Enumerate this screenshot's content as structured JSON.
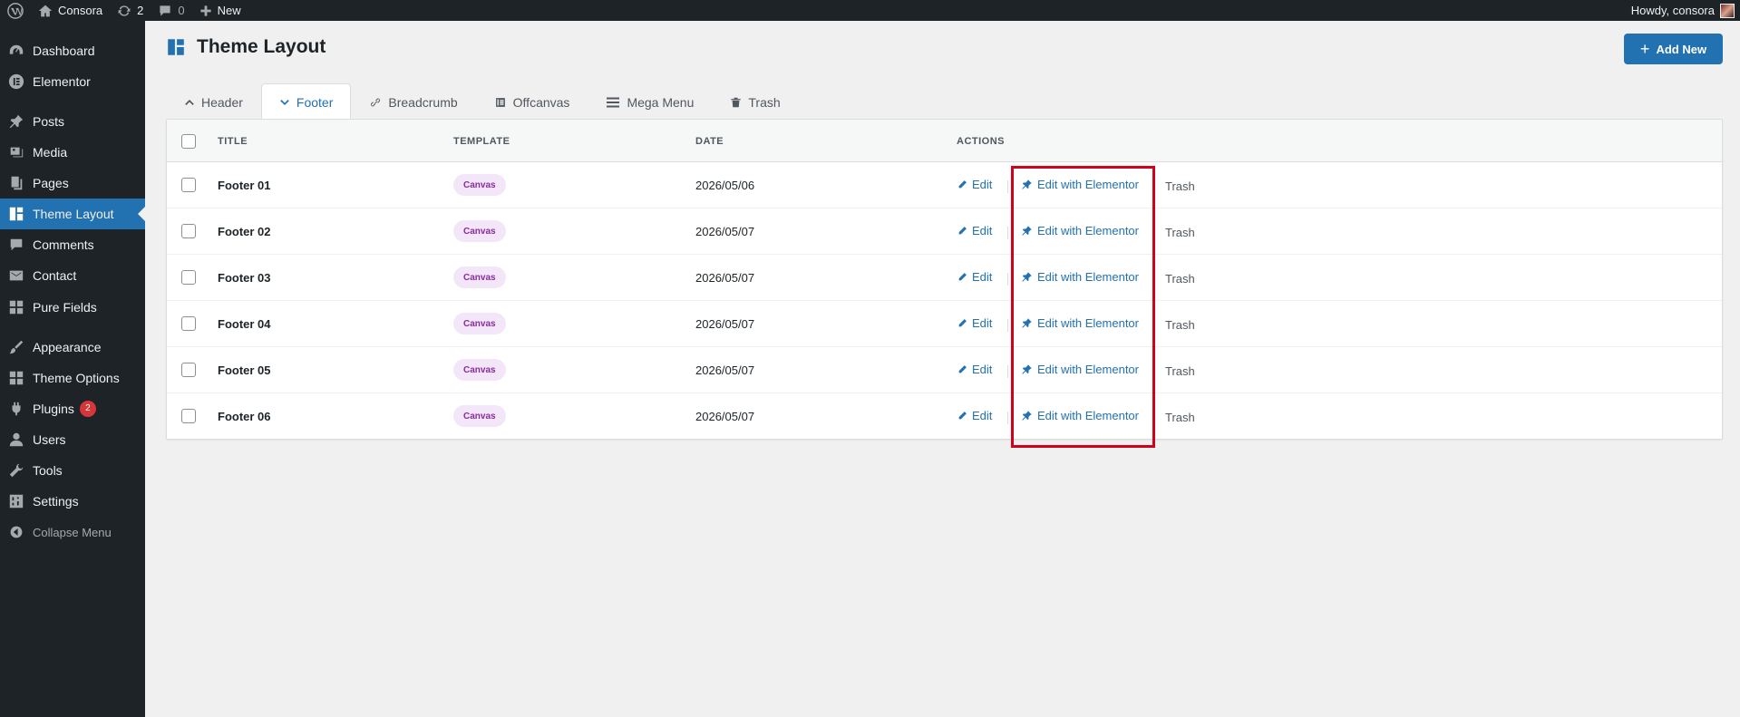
{
  "adminbar": {
    "site_name": "Consora",
    "updates_count": "2",
    "comments_count": "0",
    "new_label": "New",
    "howdy": "Howdy, consora"
  },
  "sidebar": {
    "items": [
      {
        "label": "Dashboard",
        "icon": "dashboard-icon"
      },
      {
        "label": "Elementor",
        "icon": "elementor-icon"
      },
      {
        "label": "Posts",
        "icon": "pin-icon"
      },
      {
        "label": "Media",
        "icon": "media-icon"
      },
      {
        "label": "Pages",
        "icon": "pages-icon"
      },
      {
        "label": "Theme Layout",
        "icon": "layout-icon",
        "active": true
      },
      {
        "label": "Comments",
        "icon": "comment-icon"
      },
      {
        "label": "Contact",
        "icon": "mail-icon"
      },
      {
        "label": "Pure Fields",
        "icon": "grid-icon"
      },
      {
        "label": "Appearance",
        "icon": "brush-icon"
      },
      {
        "label": "Theme Options",
        "icon": "grid-icon"
      },
      {
        "label": "Plugins",
        "icon": "plugin-icon",
        "badge": "2"
      },
      {
        "label": "Users",
        "icon": "user-icon"
      },
      {
        "label": "Tools",
        "icon": "wrench-icon"
      },
      {
        "label": "Settings",
        "icon": "settings-icon"
      },
      {
        "label": "Collapse Menu",
        "icon": "collapse-icon"
      }
    ]
  },
  "header": {
    "title": "Theme Layout",
    "add_new_label": "Add New"
  },
  "tabs": [
    {
      "label": "Header",
      "icon": "chevron-up-icon"
    },
    {
      "label": "Footer",
      "icon": "chevron-down-icon",
      "active": true
    },
    {
      "label": "Breadcrumb",
      "icon": "link-icon"
    },
    {
      "label": "Offcanvas",
      "icon": "offcanvas-icon"
    },
    {
      "label": "Mega Menu",
      "icon": "menu-icon"
    },
    {
      "label": "Trash",
      "icon": "trash-icon"
    }
  ],
  "table": {
    "columns": [
      "TITLE",
      "TEMPLATE",
      "DATE",
      "ACTIONS"
    ],
    "rows": [
      {
        "title": "Footer 01",
        "template": "Canvas",
        "date": "2026/05/06",
        "edit": "Edit",
        "edit_el": "Edit with Elementor",
        "trash": "Trash"
      },
      {
        "title": "Footer 02",
        "template": "Canvas",
        "date": "2026/05/07",
        "edit": "Edit",
        "edit_el": "Edit with Elementor",
        "trash": "Trash"
      },
      {
        "title": "Footer 03",
        "template": "Canvas",
        "date": "2026/05/07",
        "edit": "Edit",
        "edit_el": "Edit with Elementor",
        "trash": "Trash"
      },
      {
        "title": "Footer 04",
        "template": "Canvas",
        "date": "2026/05/07",
        "edit": "Edit",
        "edit_el": "Edit with Elementor",
        "trash": "Trash"
      },
      {
        "title": "Footer 05",
        "template": "Canvas",
        "date": "2026/05/07",
        "edit": "Edit",
        "edit_el": "Edit with Elementor",
        "trash": "Trash"
      },
      {
        "title": "Footer 06",
        "template": "Canvas",
        "date": "2026/05/07",
        "edit": "Edit",
        "edit_el": "Edit with Elementor",
        "trash": "Trash"
      }
    ]
  },
  "colors": {
    "accent": "#2271b1",
    "admin_dark": "#1d2327",
    "highlight": "#d0021b",
    "pill_bg": "#f3e6f8",
    "pill_text": "#8a2c9c"
  }
}
